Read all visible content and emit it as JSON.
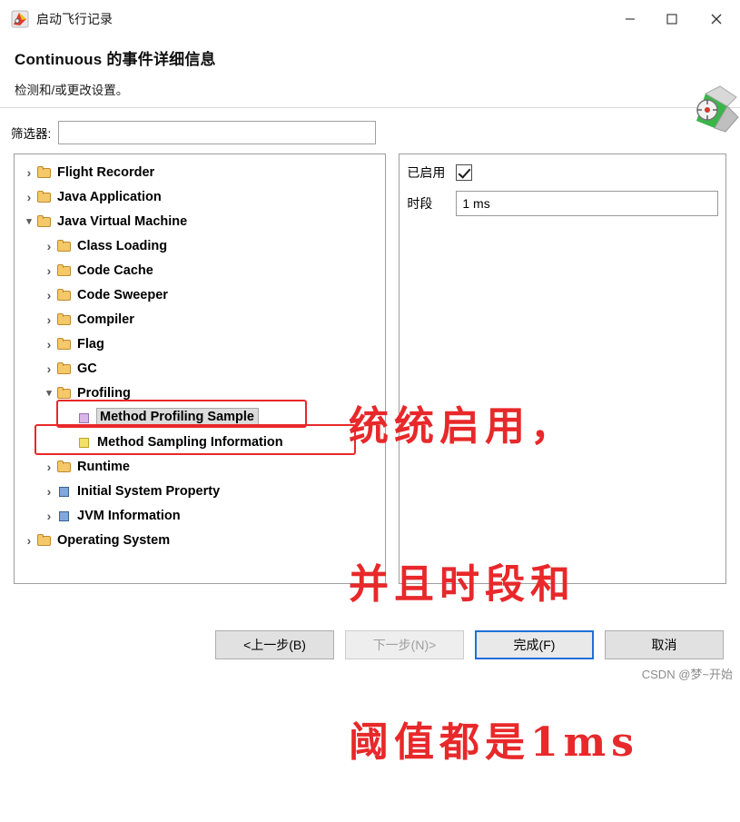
{
  "window": {
    "title": "启动飞行记录",
    "app_icon": "flight-recorder-icon",
    "minimize": "—",
    "maximize": "☐",
    "close": "✕"
  },
  "header": {
    "title": "Continuous 的事件详细信息",
    "subtitle": "检测和/或更改设置。"
  },
  "filter": {
    "label": "筛选器:",
    "value": "",
    "placeholder": ""
  },
  "tree": {
    "nodes": [
      {
        "label": "Flight Recorder",
        "icon": "folder-icon",
        "arrow": "closed",
        "indent": 1
      },
      {
        "label": "Java Application",
        "icon": "folder-icon",
        "arrow": "closed",
        "indent": 1
      },
      {
        "label": "Java Virtual Machine",
        "icon": "folder-icon",
        "arrow": "open",
        "indent": 1
      },
      {
        "label": "Class Loading",
        "icon": "folder-icon",
        "arrow": "closed",
        "indent": 2
      },
      {
        "label": "Code Cache",
        "icon": "folder-icon",
        "arrow": "closed",
        "indent": 2
      },
      {
        "label": "Code Sweeper",
        "icon": "folder-icon",
        "arrow": "closed",
        "indent": 2
      },
      {
        "label": "Compiler",
        "icon": "folder-icon",
        "arrow": "closed",
        "indent": 2
      },
      {
        "label": "Flag",
        "icon": "folder-icon",
        "arrow": "closed",
        "indent": 2
      },
      {
        "label": "GC",
        "icon": "folder-icon",
        "arrow": "closed",
        "indent": 2
      },
      {
        "label": "Profiling",
        "icon": "folder-icon",
        "arrow": "open",
        "indent": 2
      },
      {
        "label": "Method Profiling Sample",
        "icon": "purple-square-icon",
        "arrow": "none",
        "indent": 3,
        "selected": true
      },
      {
        "label": "Method Sampling Information",
        "icon": "yellow-square-icon",
        "arrow": "none",
        "indent": 3
      },
      {
        "label": "Runtime",
        "icon": "folder-icon",
        "arrow": "closed",
        "indent": 2
      },
      {
        "label": "Initial System Property",
        "icon": "blue-square-icon",
        "arrow": "closed",
        "indent": 2
      },
      {
        "label": "JVM Information",
        "icon": "blue-square-icon",
        "arrow": "closed",
        "indent": 2
      },
      {
        "label": "Operating System",
        "icon": "folder-icon",
        "arrow": "closed",
        "indent": 1
      }
    ]
  },
  "properties": {
    "enabled_label": "已启用",
    "enabled_checked": true,
    "period_label": "时段",
    "period_value": "1 ms"
  },
  "annotation": {
    "line1": "统统启用，",
    "line2": "并且时段和",
    "line3": "阈值都是1ms",
    "color": "#e8282a"
  },
  "footer": {
    "back": "<上一步(B)",
    "next": "下一步(N)>",
    "finish": "完成(F)",
    "cancel": "取消"
  },
  "watermark": "CSDN @梦~开始"
}
